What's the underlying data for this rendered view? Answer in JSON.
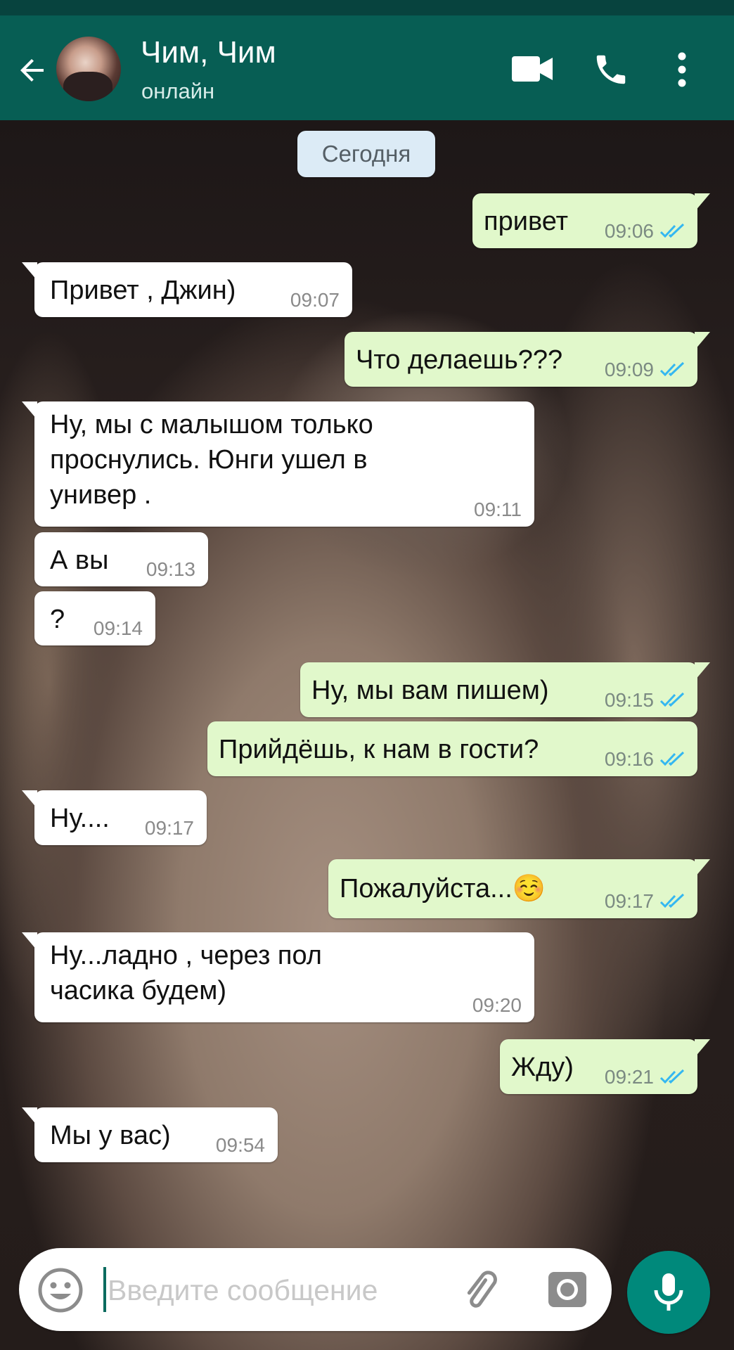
{
  "header": {
    "contact_name": "Чим, Чим",
    "contact_status": "онлайн"
  },
  "date_chip": "Сегодня",
  "messages": [
    {
      "dir": "out",
      "text": "привет",
      "time": "09:06",
      "read": true
    },
    {
      "dir": "in",
      "text": "Привет , Джин)",
      "time": "09:07"
    },
    {
      "dir": "out",
      "text": "Что делаешь???",
      "time": "09:09",
      "read": true
    },
    {
      "dir": "in",
      "text": "Ну, мы с малышом только\nпроснулись. Юнги ушел в\nунивер .",
      "time": "09:11"
    },
    {
      "dir": "in",
      "text": "А вы",
      "time": "09:13"
    },
    {
      "dir": "in",
      "text": "?",
      "time": "09:14"
    },
    {
      "dir": "out",
      "text": "Ну, мы вам пишем)",
      "time": "09:15",
      "read": true
    },
    {
      "dir": "out",
      "text": "Прийдёшь, к нам в гости?",
      "time": "09:16",
      "read": true
    },
    {
      "dir": "in",
      "text": "Ну....",
      "time": "09:17"
    },
    {
      "dir": "out",
      "text": "Пожалуйста...☺️",
      "time": "09:17",
      "read": true
    },
    {
      "dir": "in",
      "text": "Ну...ладно , через пол\nчасика будем)",
      "time": "09:20"
    },
    {
      "dir": "out",
      "text": "Жду)",
      "time": "09:21",
      "read": true
    },
    {
      "dir": "in",
      "text": "Мы у вас)",
      "time": "09:54"
    }
  ],
  "composer": {
    "placeholder": "Введите сообщение",
    "value": ""
  },
  "colors": {
    "header_bg": "#075e54",
    "outgoing_bubble": "#e1f8cb",
    "incoming_bubble": "#ffffff",
    "read_ticks": "#34b7f1",
    "mic_button": "#00897b"
  },
  "icons": [
    "back-arrow-icon",
    "video-call-icon",
    "phone-icon",
    "more-vert-icon",
    "emoji-icon",
    "attach-icon",
    "camera-icon",
    "mic-icon",
    "double-check-icon"
  ]
}
